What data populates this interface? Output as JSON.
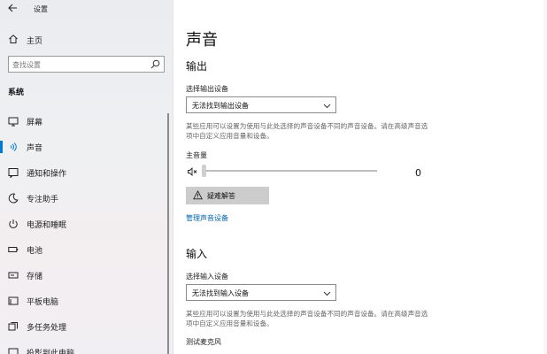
{
  "app": {
    "title": "设置"
  },
  "sidebar": {
    "home_label": "主页",
    "search": {
      "placeholder": "查找设置"
    },
    "section": "系统",
    "items": [
      {
        "label": "屏幕",
        "icon": "monitor-icon"
      },
      {
        "label": "声音",
        "icon": "speaker-icon",
        "active": true
      },
      {
        "label": "通知和操作",
        "icon": "notification-icon"
      },
      {
        "label": "专注助手",
        "icon": "moon-icon"
      },
      {
        "label": "电源和睡眠",
        "icon": "power-icon"
      },
      {
        "label": "电池",
        "icon": "battery-icon"
      },
      {
        "label": "存储",
        "icon": "storage-icon"
      },
      {
        "label": "平板电脑",
        "icon": "tablet-icon"
      },
      {
        "label": "多任务处理",
        "icon": "multitask-icon"
      },
      {
        "label": "投影到此电脑",
        "icon": "projection-icon"
      }
    ]
  },
  "main": {
    "title": "声音",
    "output": {
      "heading": "输出",
      "device_label": "选择输出设备",
      "device_value": "无法找到输出设备",
      "description": "某些应用可以设置为使用与此处选择的声音设备不同的声音设备。请在高级声音选项中自定义应用音量和设备。",
      "volume_label": "主音量",
      "volume_value": "0",
      "volume_level": 0,
      "troubleshoot_label": "疑难解答",
      "manage_link": "管理声音设备"
    },
    "input": {
      "heading": "输入",
      "device_label": "选择输入设备",
      "device_value": "无法找到输入设备",
      "description": "某些应用可以设置为使用与此处选择的声音设备不同的声音设备。请在高级声音选项中自定义应用音量和设备。",
      "mic_test_label": "测试麦克风"
    }
  },
  "colors": {
    "accent": "#0078d7",
    "link": "#0063b1"
  }
}
